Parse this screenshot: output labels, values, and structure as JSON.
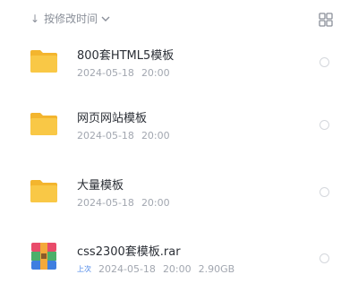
{
  "toolbar": {
    "sort_label": "按修改时间",
    "sort_arrow": "↓",
    "view_toggle_icon": "grid-view-icon"
  },
  "files": [
    {
      "name": "800套HTML5模板",
      "type": "folder",
      "date": "2024-05-18",
      "time": "20:00",
      "icon": "folder-icon"
    },
    {
      "name": "网页网站模板",
      "type": "folder",
      "date": "2024-05-18",
      "time": "20:00",
      "icon": "folder-icon"
    },
    {
      "name": "大量模板",
      "type": "folder",
      "date": "2024-05-18",
      "time": "20:00",
      "icon": "folder-icon"
    },
    {
      "name": "css2300套模板.rar",
      "type": "archive",
      "tag": "上次",
      "date": "2024-05-18",
      "time": "20:00",
      "size": "2.90GB",
      "icon": "rar-archive-icon"
    }
  ],
  "colors": {
    "folder": "#f9c846",
    "folder_tab": "#f3b52e",
    "accent": "#4a86e8",
    "text": "#2b2f36",
    "meta": "#a2a7b0"
  }
}
